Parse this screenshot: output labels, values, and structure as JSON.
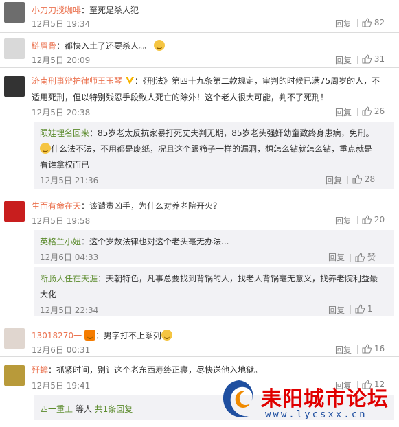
{
  "c1": {
    "user": "小刀刀搅咖啡",
    "text": "：至死是杀人犯",
    "time": "12月5日 19:34",
    "reply": "回复",
    "likes": "82"
  },
  "c2": {
    "user": "鲢眉骨",
    "text": "：都快入土了还要杀人。。",
    "time": "12月5日 20:09",
    "reply": "回复",
    "likes": "31"
  },
  "c3": {
    "user": "济南刑事辩护律师王玉琴",
    "text1": "：《刑法》第四十九条第二款规定，审判的时候已满75周岁的人，不",
    "text2": "适用死刑，但以特别残忍手段致人死亡的除外！这个老人很大可能，判不了死刑！",
    "time": "12月5日 20:38",
    "reply": "回复",
    "likes": "26",
    "sub": {
      "user": "陨娃埋名回来",
      "text1": "：85岁老太反抗家暴打死丈夫判无期，85岁老头强奸幼童致终身患病，免刑。",
      "text2": "什么法不法，不用都是废纸，况且这个跟筛子一样的漏洞，想怎么钻就怎么钻，重点就是",
      "text3": "看谁拿权而已",
      "time": "12月5日 21:36",
      "reply": "回复",
      "likes": "28"
    }
  },
  "c4": {
    "user": "生而有命在天",
    "text": "：该谴责凶手，为什么对养老院开火？",
    "time": "12月5日 19:58",
    "reply": "回复",
    "likes": "20",
    "sub1": {
      "user": "英格兰小妞",
      "text": "：这个岁数法律也对这个老头毫无办法...",
      "time": "12月6日 04:33",
      "reply": "回复",
      "likes": "赞"
    },
    "sub2": {
      "user": "断肠人任在天涯",
      "text1": "：天朝特色，凡事总要找到背锅的人，找老人背锅毫无意义，找养老院利益最",
      "text2": "大化",
      "time": "12月5日 22:34",
      "reply": "回复",
      "likes": "1"
    }
  },
  "c5": {
    "user": "13018270一",
    "text": "：男字打不上系列",
    "time": "12月6日 00:31",
    "reply": "回复",
    "likes": "16"
  },
  "c6": {
    "user": "歼蟑",
    "text": "：抓紧时间，别让这个老东西寿终正寝，尽快送他入地狱。",
    "time": "12月5日 19:41",
    "reply": "回复",
    "likes": "12",
    "more": {
      "user": "四一重工",
      "mid": " 等人 ",
      "count": "共1条回复"
    }
  },
  "watermark": {
    "title": "耒阳城市论坛",
    "url": "www.lycsxx.cn"
  }
}
